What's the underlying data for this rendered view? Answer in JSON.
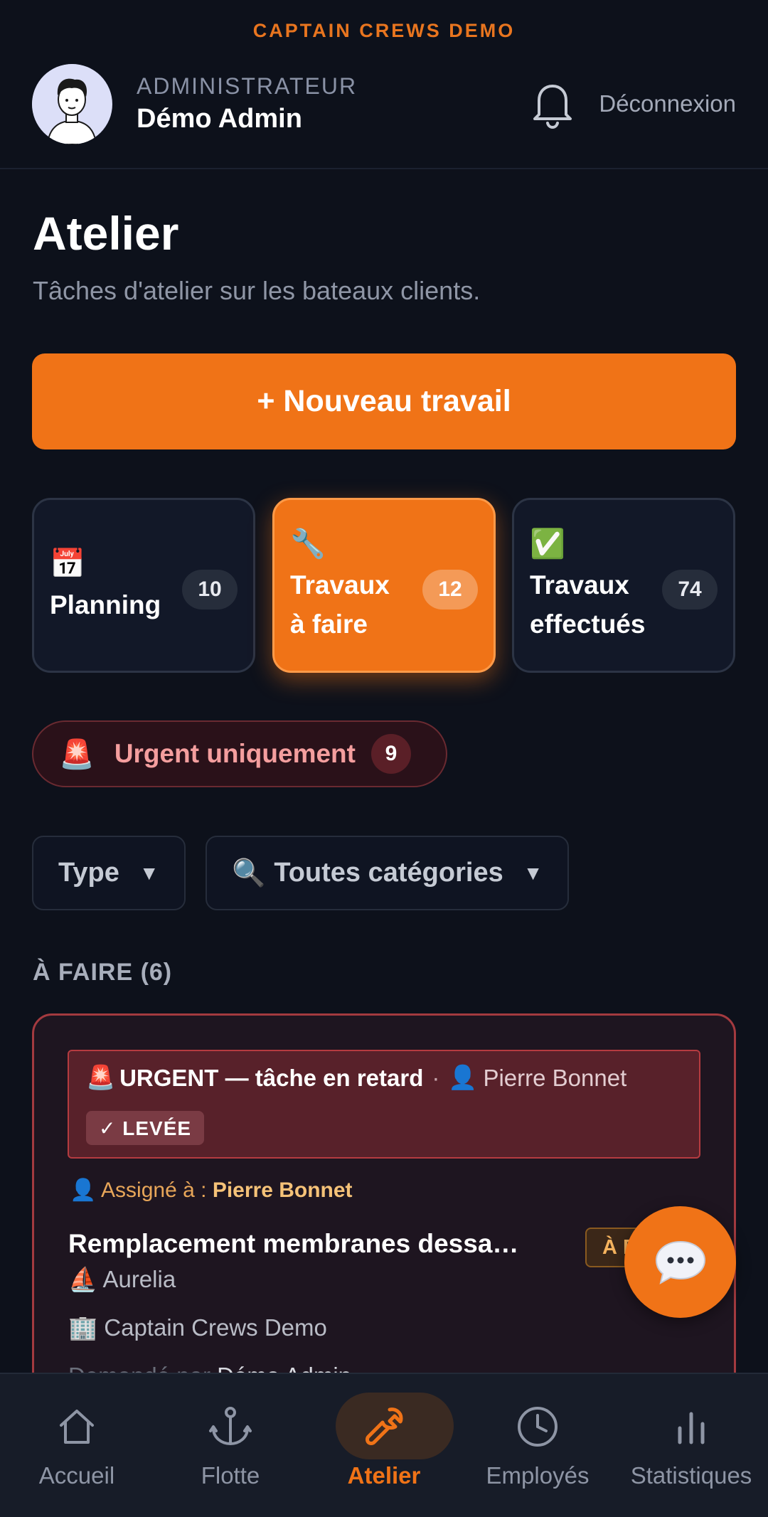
{
  "brand": "CAPTAIN CREWS DEMO",
  "user": {
    "role": "ADMINISTRATEUR",
    "name": "Démo Admin",
    "logout": "Déconnexion"
  },
  "page": {
    "title": "Atelier",
    "subtitle": "Tâches d'atelier sur les bateaux clients."
  },
  "new_job_button": "+ Nouveau travail",
  "tabs": [
    {
      "icon": "📅",
      "label_line1": "Planning",
      "label_line2": "",
      "count": "10",
      "active": false
    },
    {
      "icon": "🔧",
      "label_line1": "Travaux",
      "label_line2": "à faire",
      "count": "12",
      "active": true
    },
    {
      "icon": "✅",
      "label_line1": "Travaux",
      "label_line2": "effectués",
      "count": "74",
      "active": false
    }
  ],
  "urgent_filter": {
    "icon": "🚨",
    "label": "Urgent uniquement",
    "count": "9"
  },
  "filters": {
    "type": "Type",
    "category_icon": "🔍",
    "category": "Toutes catégories",
    "caret": "▼"
  },
  "section_title": "À FAIRE (6)",
  "card": {
    "alert_icon": "🚨",
    "alert_text": "URGENT — tâche en retard",
    "alert_sep": "·",
    "alert_person_icon": "👤",
    "alert_person": "Pierre Bonnet",
    "lifted_badge": "✓ LEVÉE",
    "assigned_icon": "👤",
    "assigned_label": "Assigné à :",
    "assigned_name": "Pierre Bonnet",
    "title": "Remplacement membranes dessa…",
    "status": "À FAIRE",
    "boat_icon": "⛵",
    "boat": "Aurelia",
    "company_icon": "🏢",
    "company": "Captain Crews Demo",
    "requested_label": "Demandé par",
    "requested_by": "Démo Admin"
  },
  "nav": [
    {
      "label": "Accueil",
      "icon": "home-icon",
      "active": false
    },
    {
      "label": "Flotte",
      "icon": "anchor-icon",
      "active": false
    },
    {
      "label": "Atelier",
      "icon": "wrench-icon",
      "active": true
    },
    {
      "label": "Employés",
      "icon": "clock-icon",
      "active": false
    },
    {
      "label": "Statistiques",
      "icon": "bar-chart-icon",
      "active": false
    }
  ],
  "colors": {
    "accent": "#f07317",
    "background": "#0d111b",
    "urgent": "#a33a3f"
  }
}
